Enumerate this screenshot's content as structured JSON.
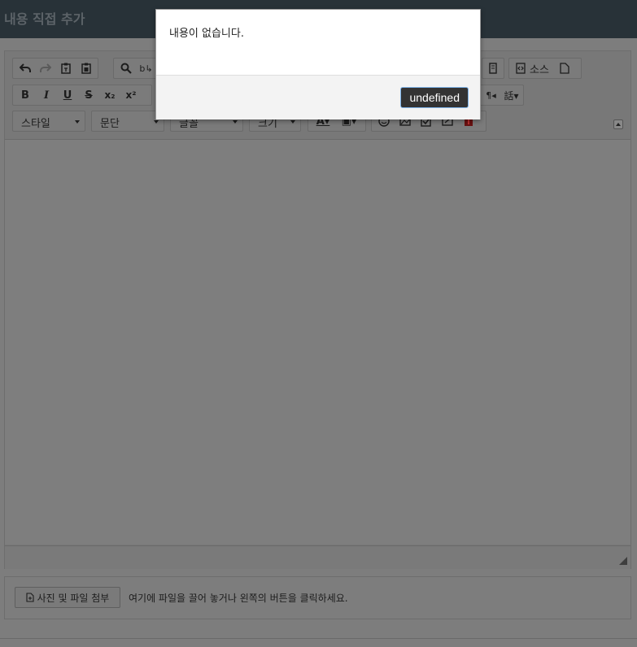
{
  "page": {
    "title": "내용 직접 추가"
  },
  "toolbar": {
    "source_label": "소스",
    "style_combo": "스타일",
    "format_combo": "문단",
    "font_combo": "글꼴",
    "size_combo": "크기",
    "bold": "B",
    "italic": "I",
    "underline": "U",
    "strike": "S",
    "subscript": "x₂",
    "superscript": "x²",
    "icons": [
      "undo-icon",
      "redo-icon",
      "paste-text-icon",
      "paste-word-icon",
      "search-icon",
      "replace-icon",
      "source-icon",
      "document-icon",
      "text-color-icon",
      "background-color-icon",
      "emoji-icon",
      "image-icon",
      "checkbox-icon",
      "image-edit-icon",
      "flash-icon"
    ]
  },
  "attachment": {
    "button_label": "사진 및 파일 첨부",
    "hint": "여기에 파일을 끌어 놓거나 왼쪽의 버튼을 클릭하세요."
  },
  "dialog": {
    "message": "내용이 없습니다.",
    "ok_label": "undefined"
  },
  "colors": {
    "overlay": "#7d7d7d",
    "titlebar": "#283238",
    "dialog_button": "#333333",
    "dialog_button_border": "#7fb4ea"
  }
}
